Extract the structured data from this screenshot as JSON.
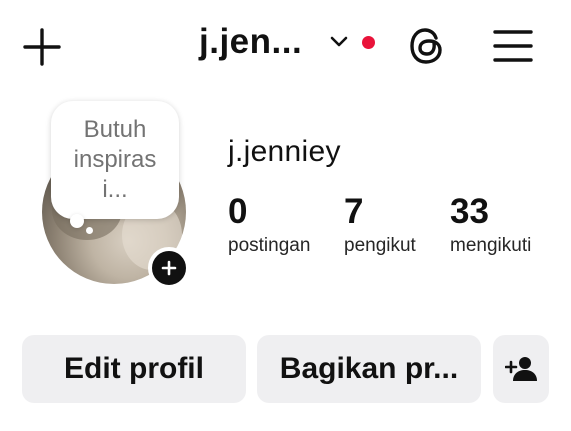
{
  "topbar": {
    "username": "j.jen...",
    "icons": [
      "plus-icon",
      "chevron-down-icon",
      "threads-icon",
      "menu-icon"
    ],
    "notification_dot_color": "#e9133a"
  },
  "profile": {
    "note": "Butuh inspiras i...",
    "display_name": "j.jenniey",
    "stats": [
      {
        "value": "0",
        "label": "postingan"
      },
      {
        "value": "7",
        "label": "pengikut"
      },
      {
        "value": "33",
        "label": "mengikuti"
      }
    ]
  },
  "actions": {
    "edit_label": "Edit profil",
    "share_label": "Bagikan pr...",
    "add_user_icon": "add-user-icon"
  }
}
